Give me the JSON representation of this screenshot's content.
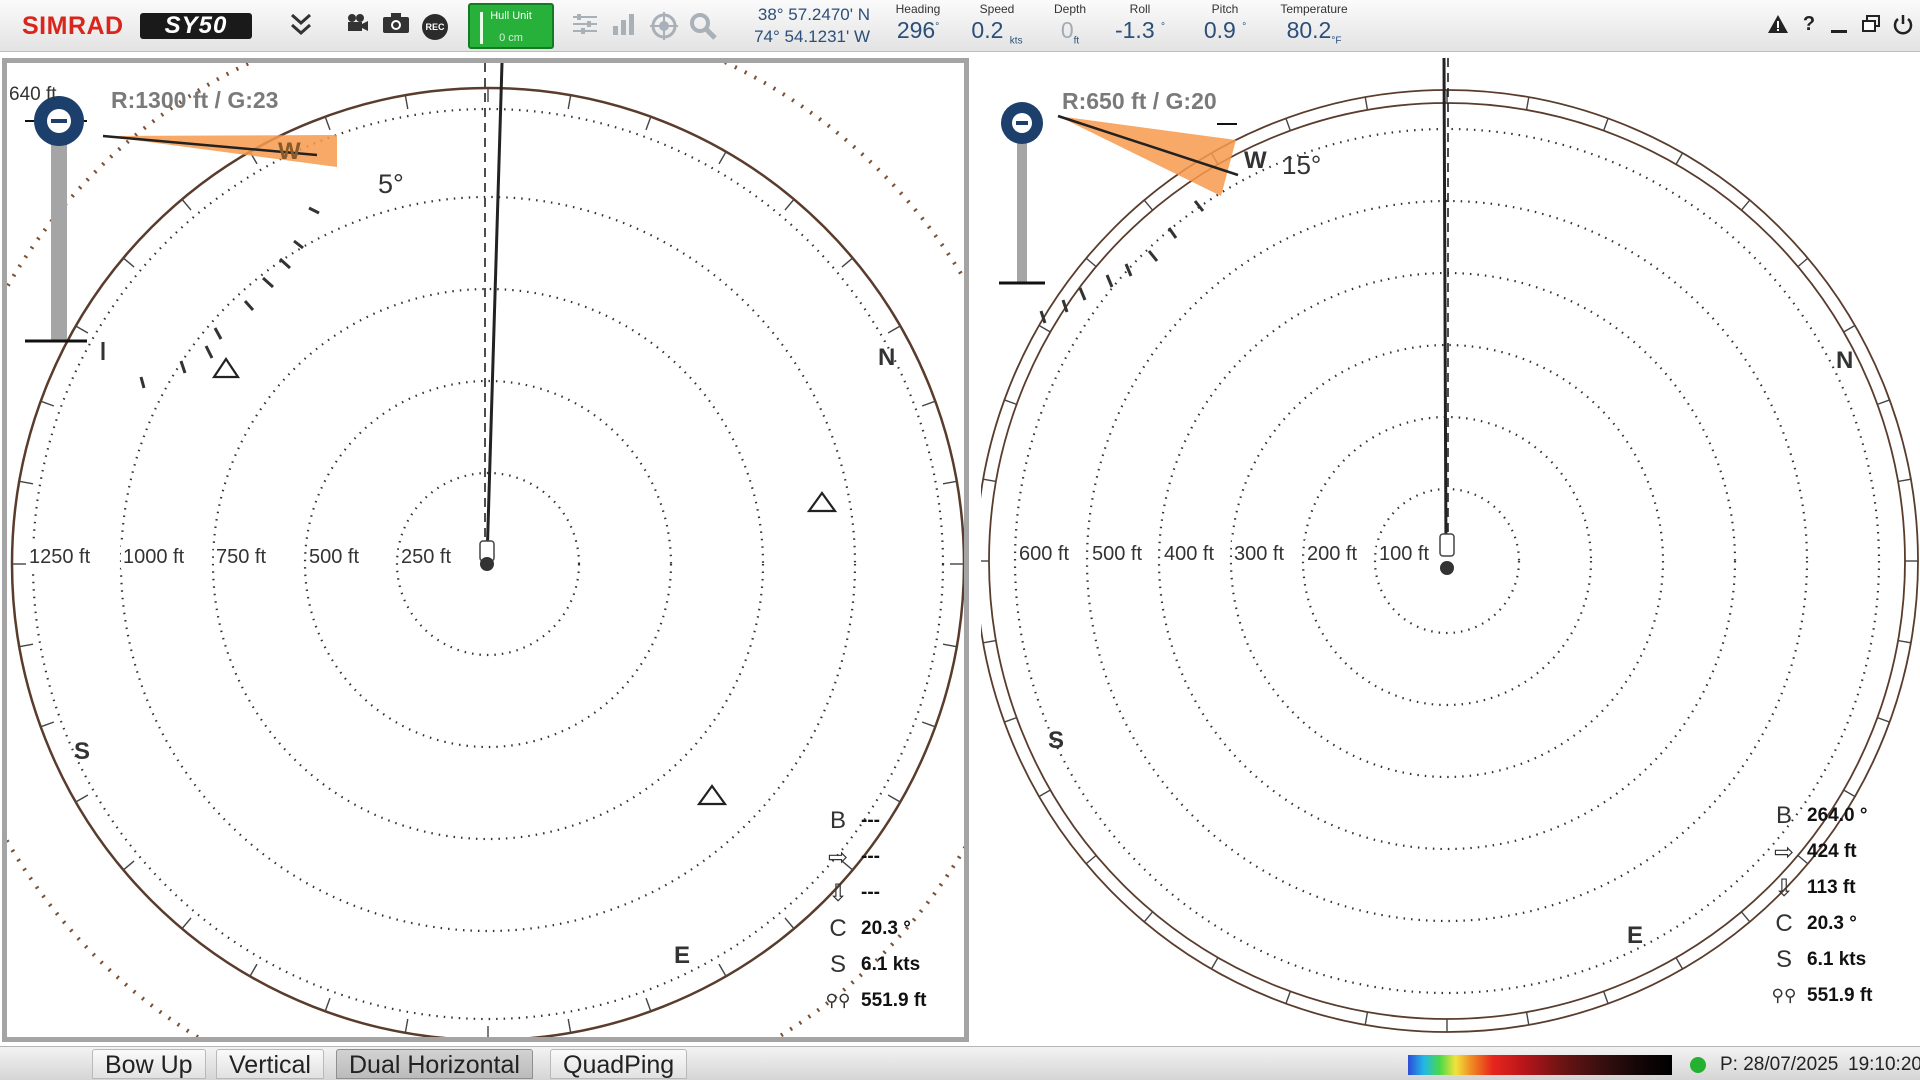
{
  "toolbar": {
    "brand": "SIMRAD",
    "model": "SY50",
    "icons": [
      "chevron-double-down-icon",
      "video-camera-icon",
      "photo-camera-icon",
      "record-icon",
      "settings-sliders-icon",
      "bar-chart-icon",
      "target-icon",
      "magnifier-icon"
    ],
    "record_label": "REC",
    "hull_unit": {
      "label": "Hull Unit",
      "value": "0 cm"
    },
    "position": {
      "lat": "38° 57.2470' N",
      "lon": "74° 54.1231' W"
    },
    "heading": {
      "label": "Heading",
      "value": "296",
      "unit": "°"
    },
    "speed": {
      "label": "Speed",
      "value": "0.2",
      "unit": "kts"
    },
    "depth": {
      "label": "Depth",
      "value": "0",
      "unit": "ft"
    },
    "roll": {
      "label": "Roll",
      "value": "-1.3",
      "unit": "°"
    },
    "pitch": {
      "label": "Pitch",
      "value": "0.9",
      "unit": "°"
    },
    "temperature": {
      "label": "Temperature",
      "value": "80.2",
      "unit": "°F"
    },
    "right_icons": [
      "warning-icon",
      "help-icon",
      "minimize-icon",
      "restore-icon",
      "power-icon"
    ]
  },
  "left_view": {
    "range_gain": "R:1300 ft  / G:23",
    "slider_value_label": "640 ft",
    "tilt_label": "5°",
    "bearing_wedge_label": "W",
    "range_rings": [
      "250 ft",
      "500 ft",
      "750 ft",
      "1000 ft",
      "1250 ft"
    ],
    "cardinals": {
      "n": "N",
      "s": "S",
      "e": "E"
    },
    "info": {
      "bearing": "---",
      "horizontal": "---",
      "vertical": "---",
      "course": "20.3 °",
      "speed": "6.1 kts",
      "depth": "551.9 ft"
    }
  },
  "right_view": {
    "range_gain": "R:650 ft  / G:20",
    "tilt_label": "15°",
    "bearing_wedge_label": "W",
    "range_rings": [
      "100 ft",
      "200 ft",
      "300 ft",
      "400 ft",
      "500 ft",
      "600 ft"
    ],
    "cardinals": {
      "n": "N",
      "s": "S",
      "e": "E"
    },
    "info": {
      "bearing": "264.0 °",
      "horizontal": "424 ft",
      "vertical": "113 ft",
      "course": "20.3 °",
      "speed": "6.1 kts",
      "depth": "551.9 ft"
    }
  },
  "info_symbols": {
    "bearing": "B",
    "course": "C",
    "speed": "S"
  },
  "bottom": {
    "tabs": [
      "Bow Up",
      "Vertical",
      "Dual Horizontal",
      "QuadPing"
    ],
    "active_tab": "Dual Horizontal",
    "date": "P: 28/07/2025",
    "time": "19:10:20",
    "status_color": "#23b12f"
  },
  "colors": {
    "accent": "#2b4f79",
    "brand": "#d9261c",
    "wedge": "#f79a4e",
    "hull_unit": "#27b03a",
    "slider_knob": "#1c3f6b"
  }
}
